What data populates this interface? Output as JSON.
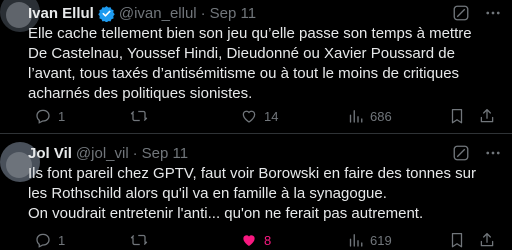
{
  "colors": {
    "background": "#000000",
    "text": "#e7e9ea",
    "muted": "#71767b",
    "verified": "#1d9bf0",
    "like_active": "#f91880",
    "divider": "#2f3336"
  },
  "tweets": [
    {
      "author": "Ivan Ellul",
      "handle": "@ivan_ellul",
      "separator": "·",
      "date": "Sep 11",
      "verified": true,
      "text": "Elle cache tellement bien son jeu qu’elle passe son temps à mettre De Castelnau, Youssef Hindi, Dieudonné ou Xavier Poussard de l’avant, tous taxés d’antisémitisme ou à tout le moins de critiques acharnés des politiques sionistes.",
      "replies": "1",
      "retweets": "",
      "likes": "14",
      "liked": false,
      "views": "686",
      "icons": [
        "grok-icon",
        "more-icon",
        "reply-icon",
        "retweet-icon",
        "heart-icon",
        "views-icon",
        "bookmark-icon",
        "share-icon"
      ]
    },
    {
      "author": "Jol Vil",
      "handle": "@jol_vil",
      "separator": "·",
      "date": "Sep 11",
      "verified": false,
      "text": "Ils font pareil chez GPTV, faut voir Borowski en faire des tonnes sur les Rothschild alors qu'il va en famille à la synagogue.\nOn voudrait entretenir l'anti... qu'on ne ferait pas autrement.",
      "replies": "1",
      "retweets": "",
      "likes": "8",
      "liked": true,
      "views": "619",
      "icons": [
        "grok-icon",
        "more-icon",
        "reply-icon",
        "retweet-icon",
        "heart-filled-icon",
        "views-icon",
        "bookmark-icon",
        "share-icon"
      ]
    }
  ]
}
